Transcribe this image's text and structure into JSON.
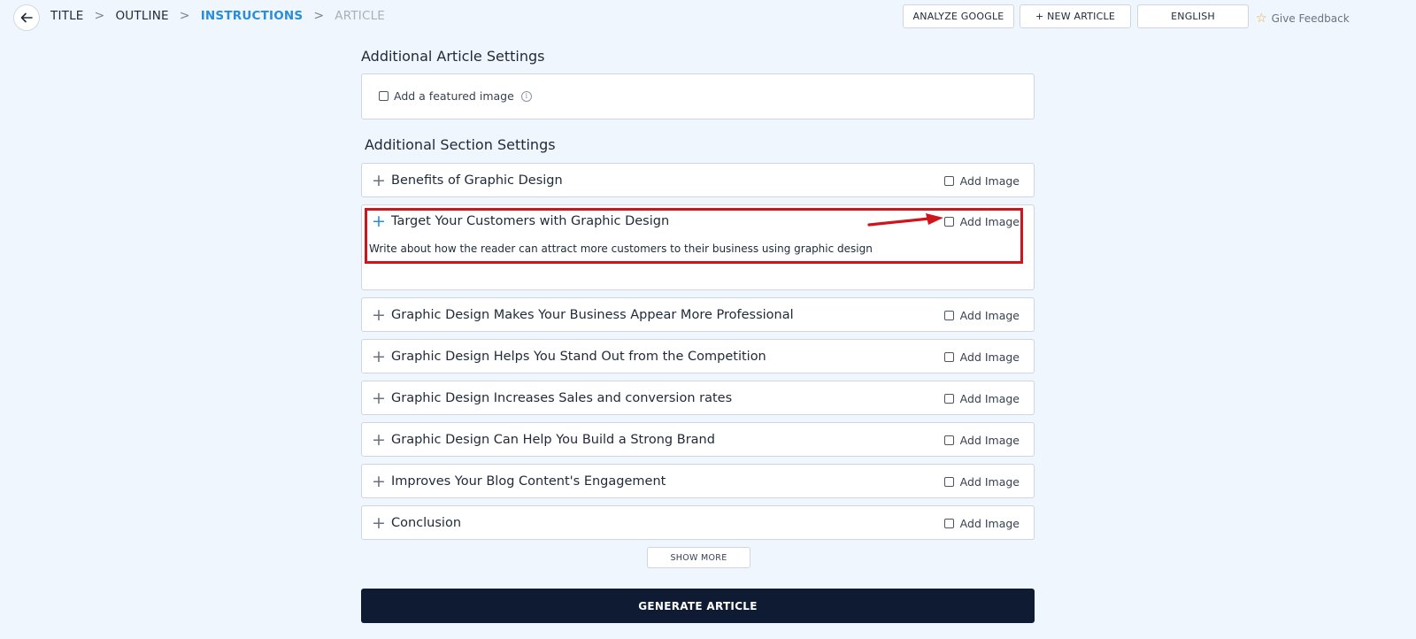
{
  "breadcrumb": {
    "items": [
      {
        "label": "TITLE",
        "state": "done"
      },
      {
        "label": "OUTLINE",
        "state": "done"
      },
      {
        "label": "INSTRUCTIONS",
        "state": "active"
      },
      {
        "label": "ARTICLE",
        "state": "disabled"
      }
    ],
    "separator": ">"
  },
  "toolbar": {
    "analyze_label": "ANALYZE GOOGLE",
    "new_article_label": "+ NEW ARTICLE",
    "language_label": "ENGLISH",
    "feedback_label": "Give Feedback",
    "feedback_icon": "star-icon"
  },
  "article_settings": {
    "heading": "Additional Article Settings",
    "featured_image_label": "Add a featured image",
    "featured_image_checked": false
  },
  "section_settings": {
    "heading": "Additional Section Settings",
    "add_image_label": "Add Image",
    "sections": [
      {
        "title": "Benefits of Graphic Design",
        "add_image": false
      },
      {
        "title": "Target Your Customers with Graphic Design",
        "add_image": false,
        "expanded": true,
        "instructions": "Write about how the reader can attract more customers to their business using graphic design"
      },
      {
        "title": "Graphic Design Makes Your Business Appear More Professional",
        "add_image": false
      },
      {
        "title": "Graphic Design Helps You Stand Out from the Competition",
        "add_image": false
      },
      {
        "title": "Graphic Design Increases Sales and conversion rates",
        "add_image": false
      },
      {
        "title": "Graphic Design Can Help You Build a Strong Brand",
        "add_image": false
      },
      {
        "title": "Improves Your Blog Content's Engagement",
        "add_image": false
      },
      {
        "title": "Conclusion",
        "add_image": false
      }
    ]
  },
  "show_more_label": "SHOW MORE",
  "generate_label": "GENERATE ARTICLE",
  "colors": {
    "accent": "#2a8dd6",
    "primary_button": "#0f1b33",
    "annotation": "#d0141c",
    "background": "#f0f6fd"
  }
}
